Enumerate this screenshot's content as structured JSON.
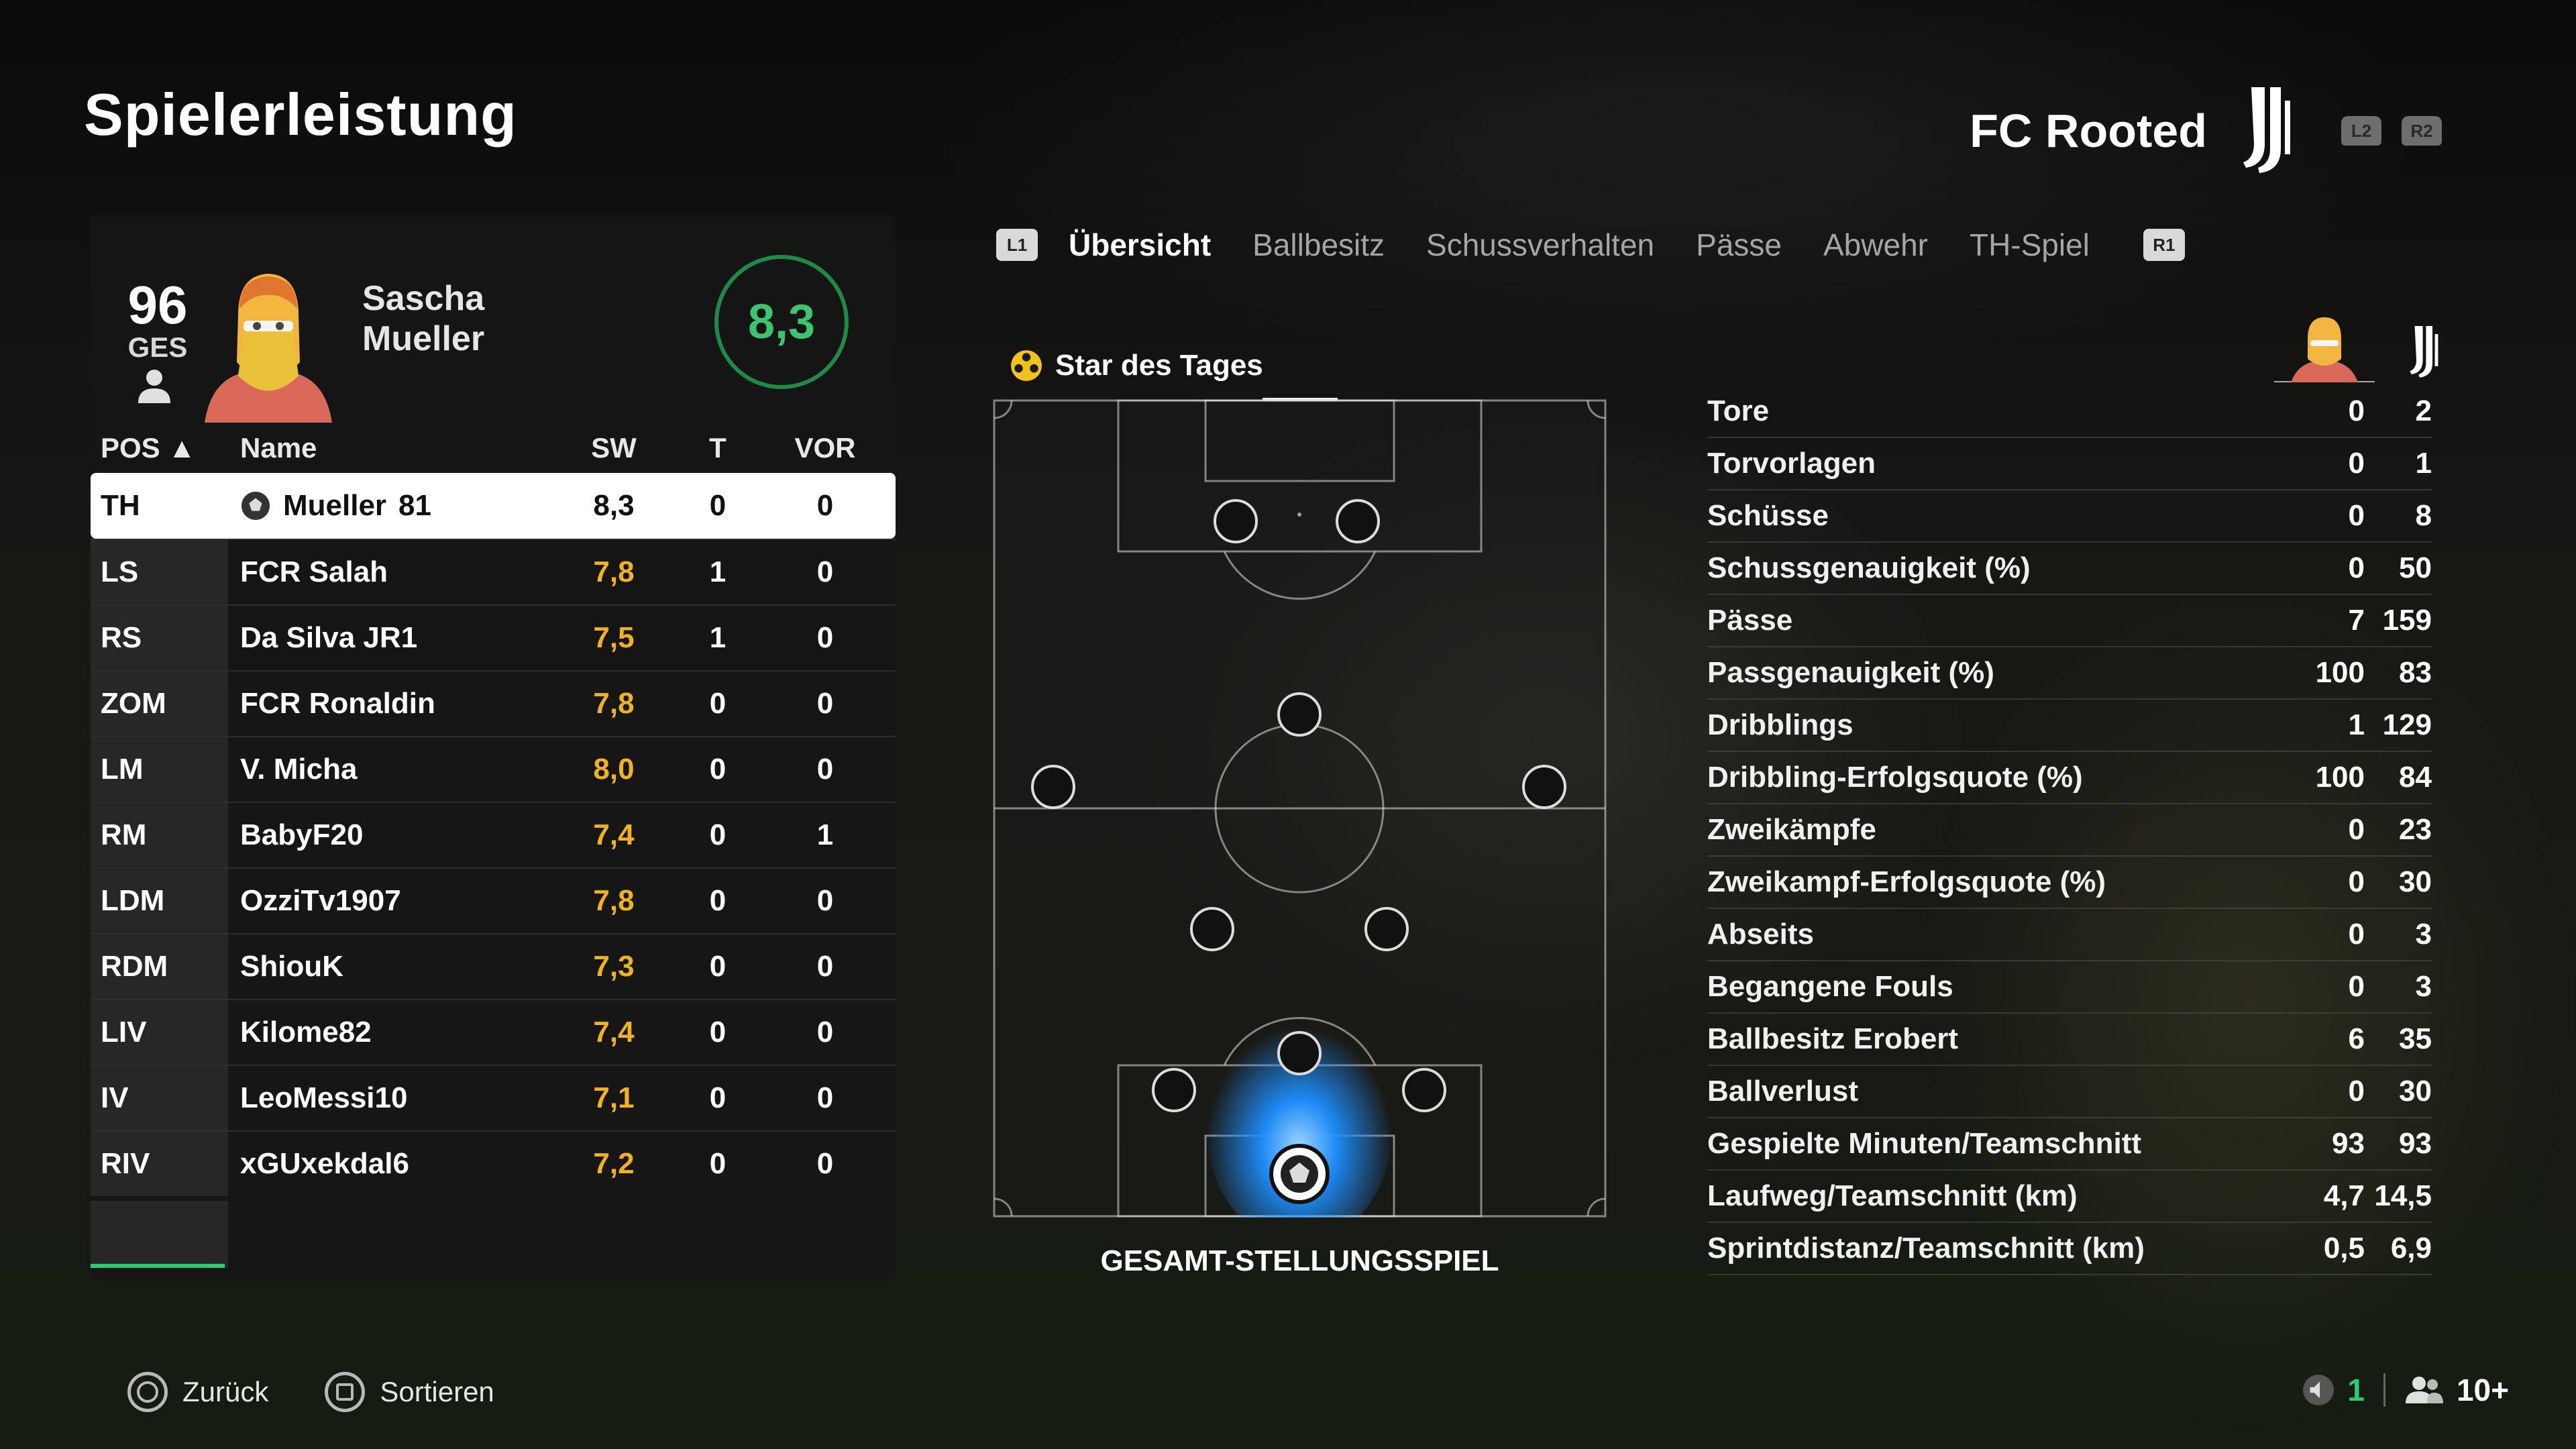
{
  "header": {
    "title": "Spielerleistung",
    "team_name": "FC Rooted",
    "trigger_left": "L2",
    "trigger_right": "R2"
  },
  "player_card": {
    "overall": "96",
    "overall_label": "GES",
    "first_name": "Sascha",
    "last_name": "Mueller",
    "match_rating": "8,3"
  },
  "table": {
    "headers": {
      "pos": "POS",
      "pos_sort": "▲",
      "name": "Name",
      "sw": "SW",
      "t": "T",
      "vor": "VOR"
    },
    "rows": [
      {
        "pos": "TH",
        "name": "Mueller",
        "number": "81",
        "sw": "8,3",
        "t": "0",
        "vor": "0"
      },
      {
        "pos": "LS",
        "name": "FCR Salah",
        "sw": "7,8",
        "t": "1",
        "vor": "0"
      },
      {
        "pos": "RS",
        "name": "Da Silva JR1",
        "sw": "7,5",
        "t": "1",
        "vor": "0"
      },
      {
        "pos": "ZOM",
        "name": "FCR Ronaldin",
        "sw": "7,8",
        "t": "0",
        "vor": "0"
      },
      {
        "pos": "LM",
        "name": "V. Micha",
        "sw": "8,0",
        "t": "0",
        "vor": "0"
      },
      {
        "pos": "RM",
        "name": "BabyF20",
        "sw": "7,4",
        "t": "0",
        "vor": "1"
      },
      {
        "pos": "LDM",
        "name": "OzziTv1907",
        "sw": "7,8",
        "t": "0",
        "vor": "0"
      },
      {
        "pos": "RDM",
        "name": "ShiouK",
        "sw": "7,3",
        "t": "0",
        "vor": "0"
      },
      {
        "pos": "LIV",
        "name": "Kilome82",
        "sw": "7,4",
        "t": "0",
        "vor": "0"
      },
      {
        "pos": "IV",
        "name": "LeoMessi10",
        "sw": "7,1",
        "t": "0",
        "vor": "0"
      },
      {
        "pos": "RIV",
        "name": "xGUxekdal6",
        "sw": "7,2",
        "t": "0",
        "vor": "0"
      }
    ]
  },
  "tabs": {
    "left_button": "L1",
    "right_button": "R1",
    "items": [
      "Übersicht",
      "Ballbesitz",
      "Schussverhalten",
      "Pässe",
      "Abwehr",
      "TH-Spiel"
    ],
    "active_index": 0
  },
  "pitch": {
    "star_label": "Star des Tages",
    "caption": "GESAMT-STELLUNGSSPIEL"
  },
  "stats": [
    {
      "label": "Tore",
      "player": "0",
      "team": "2"
    },
    {
      "label": "Torvorlagen",
      "player": "0",
      "team": "1"
    },
    {
      "label": "Schüsse",
      "player": "0",
      "team": "8"
    },
    {
      "label": "Schussgenauigkeit (%)",
      "player": "0",
      "team": "50"
    },
    {
      "label": "Pässe",
      "player": "7",
      "team": "159"
    },
    {
      "label": "Passgenauigkeit (%)",
      "player": "100",
      "team": "83"
    },
    {
      "label": "Dribblings",
      "player": "1",
      "team": "129"
    },
    {
      "label": "Dribbling-Erfolgsquote (%)",
      "player": "100",
      "team": "84"
    },
    {
      "label": "Zweikämpfe",
      "player": "0",
      "team": "23"
    },
    {
      "label": "Zweikampf-Erfolgsquote (%)",
      "player": "0",
      "team": "30"
    },
    {
      "label": "Abseits",
      "player": "0",
      "team": "3"
    },
    {
      "label": "Begangene Fouls",
      "player": "0",
      "team": "3"
    },
    {
      "label": "Ballbesitz Erobert",
      "player": "6",
      "team": "35"
    },
    {
      "label": "Ballverlust",
      "player": "0",
      "team": "30"
    },
    {
      "label": "Gespielte Minuten/Teamschnitt",
      "player": "93",
      "team": "93"
    },
    {
      "label": "Laufweg/Teamschnitt (km)",
      "player": "4,7",
      "team": "14,5"
    },
    {
      "label": "Sprintdistanz/Teamschnitt (km)",
      "player": "0,5",
      "team": "6,9"
    }
  ],
  "footer": {
    "back_label": "Zurück",
    "sort_label": "Sortieren",
    "count_value": "1",
    "players_value": "10+"
  },
  "colors": {
    "accent_green": "#2ecc71",
    "rating_gold": "#f2b21c",
    "heat_blue": "#1e90ff"
  }
}
